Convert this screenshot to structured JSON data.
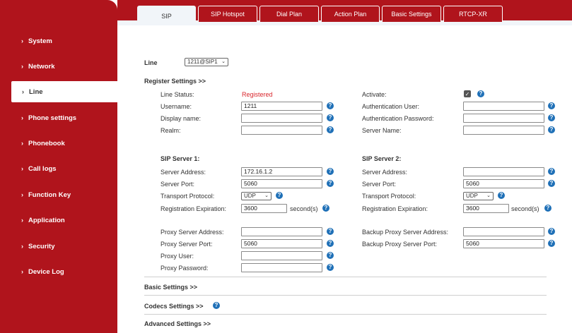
{
  "sidebar": {
    "items": [
      {
        "label": "System"
      },
      {
        "label": "Network"
      },
      {
        "label": "Line"
      },
      {
        "label": "Phone settings"
      },
      {
        "label": "Phonebook"
      },
      {
        "label": "Call logs"
      },
      {
        "label": "Function Key"
      },
      {
        "label": "Application"
      },
      {
        "label": "Security"
      },
      {
        "label": "Device Log"
      }
    ],
    "chevron": "›"
  },
  "tabs": [
    {
      "label": "SIP"
    },
    {
      "label": "SIP Hotspot"
    },
    {
      "label": "Dial Plan"
    },
    {
      "label": "Action Plan"
    },
    {
      "label": "Basic Settings"
    },
    {
      "label": "RTCP-XR"
    }
  ],
  "line": {
    "label": "Line",
    "selected": "1211@SIP1"
  },
  "register": {
    "header": "Register Settings >>",
    "line_status_label": "Line Status:",
    "line_status_value": "Registered",
    "username_label": "Username:",
    "username_value": "1211",
    "display_name_label": "Display name:",
    "display_name_value": "",
    "realm_label": "Realm:",
    "realm_value": "",
    "activate_label": "Activate:",
    "activate_checked": true,
    "auth_user_label": "Authentication User:",
    "auth_user_value": "",
    "auth_password_label": "Authentication Password:",
    "auth_password_value": "",
    "server_name_label": "Server Name:",
    "server_name_value": ""
  },
  "sip1": {
    "title": "SIP Server 1:",
    "address_label": "Server Address:",
    "address_value": "172.16.1.2",
    "port_label": "Server Port:",
    "port_value": "5060",
    "transport_label": "Transport Protocol:",
    "transport_value": "UDP",
    "expiration_label": "Registration Expiration:",
    "expiration_value": "3600",
    "unit": "second(s)"
  },
  "sip2": {
    "title": "SIP Server 2:",
    "address_label": "Server Address:",
    "address_value": "",
    "port_label": "Server Port:",
    "port_value": "5060",
    "transport_label": "Transport Protocol:",
    "transport_value": "UDP",
    "expiration_label": "Registration Expiration:",
    "expiration_value": "3600",
    "unit": "second(s)"
  },
  "proxy": {
    "address_label": "Proxy Server Address:",
    "address_value": "",
    "port_label": "Proxy Server Port:",
    "port_value": "5060",
    "user_label": "Proxy User:",
    "user_value": "",
    "password_label": "Proxy Password:",
    "password_value": "",
    "backup_address_label": "Backup Proxy Server Address:",
    "backup_address_value": "",
    "backup_port_label": "Backup Proxy Server Port:",
    "backup_port_value": "5060"
  },
  "sections": {
    "basic": "Basic Settings >>",
    "codecs": "Codecs Settings >>",
    "advanced": "Advanced Settings >>"
  },
  "icons": {
    "help": "?",
    "check": "✓",
    "dropdown": "⌄"
  },
  "colors": {
    "brand_red": "#b0141c",
    "status_red": "#d9262c",
    "help_blue": "#1f70b7"
  }
}
